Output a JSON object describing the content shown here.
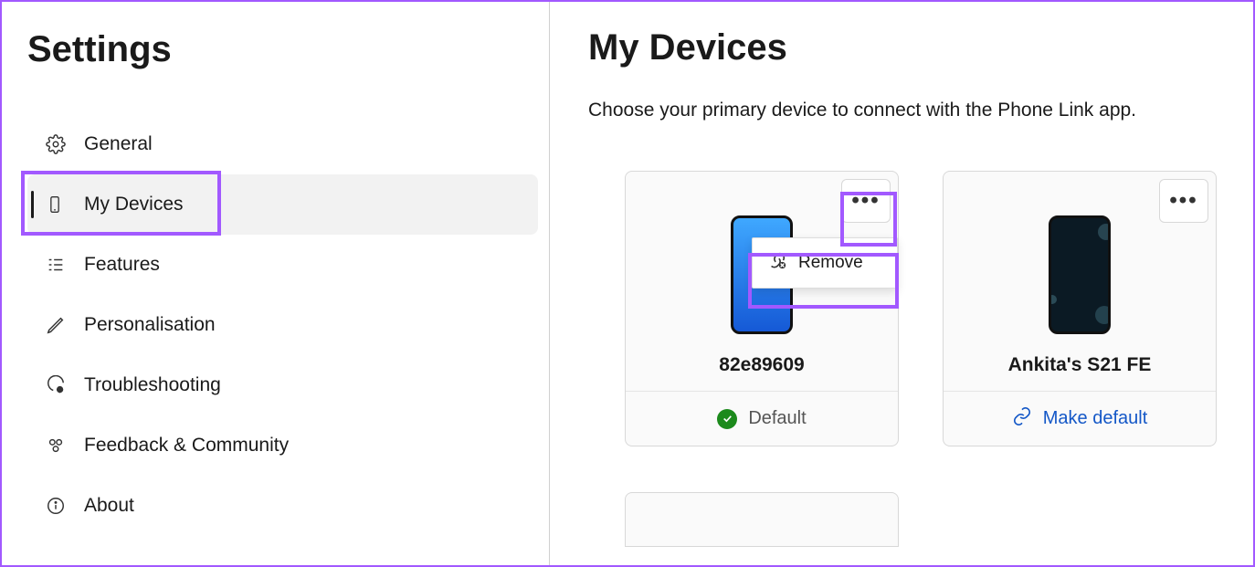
{
  "sidebar": {
    "title": "Settings",
    "items": [
      {
        "label": "General"
      },
      {
        "label": "My Devices"
      },
      {
        "label": "Features"
      },
      {
        "label": "Personalisation"
      },
      {
        "label": "Troubleshooting"
      },
      {
        "label": "Feedback & Community"
      },
      {
        "label": "About"
      }
    ]
  },
  "main": {
    "title": "My Devices",
    "subtitle": "Choose your primary device to connect with the Phone Link app."
  },
  "devices": [
    {
      "name": "82e89609",
      "status_label": "Default",
      "more_dots": "•••"
    },
    {
      "name": "Ankita's S21 FE",
      "action_label": "Make default",
      "more_dots": "•••"
    }
  ],
  "popup": {
    "remove_label": "Remove"
  }
}
